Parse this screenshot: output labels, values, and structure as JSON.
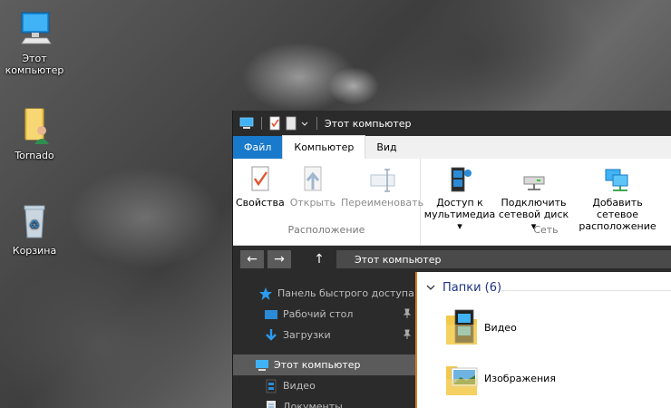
{
  "desktop": {
    "icons": [
      {
        "label_line1": "Этот",
        "label_line2": "компьютер",
        "icon": "computer-icon"
      },
      {
        "label_line1": "Tornado",
        "label_line2": "",
        "icon": "user-folder-icon"
      },
      {
        "label_line1": "Корзина",
        "label_line2": "",
        "icon": "recycle-bin-icon"
      }
    ]
  },
  "window": {
    "title": "Этот компьютер",
    "tabs": [
      {
        "label": "Файл"
      },
      {
        "label": "Компьютер"
      },
      {
        "label": "Вид"
      }
    ],
    "ribbon": {
      "groups": [
        {
          "label": "Расположение",
          "buttons": [
            {
              "label": "Свойства",
              "icon": "properties-icon"
            },
            {
              "label": "Открыть",
              "icon": "open-icon"
            },
            {
              "label": "Переименовать",
              "icon": "rename-icon"
            }
          ]
        },
        {
          "label": "Сеть",
          "buttons": [
            {
              "label_line1": "Доступ к",
              "label_line2": "мультимедиа ▾",
              "icon": "media-access-icon"
            },
            {
              "label_line1": "Подключить",
              "label_line2": "сетевой диск ▾",
              "icon": "map-drive-icon"
            },
            {
              "label_line1": "Добавить сетевое",
              "label_line2": "расположение",
              "icon": "network-location-icon"
            }
          ]
        }
      ]
    },
    "address": {
      "path": "Этот компьютер"
    },
    "nav": {
      "items": [
        {
          "label": "Панель быстрого доступа",
          "icon": "star-icon"
        },
        {
          "label": "Рабочий стол",
          "icon": "desktop-icon",
          "pinned": true
        },
        {
          "label": "Загрузки",
          "icon": "download-icon",
          "pinned": true
        },
        {
          "label": "Этот компьютер",
          "icon": "computer-icon",
          "selected": true
        },
        {
          "label": "Видео",
          "icon": "video-icon"
        },
        {
          "label": "Документы",
          "icon": "documents-icon"
        }
      ]
    },
    "content": {
      "section_title": "Папки (6)",
      "folders": [
        {
          "label": "Видео",
          "icon": "video-folder-icon"
        },
        {
          "label": "Изображения",
          "icon": "pictures-folder-icon"
        }
      ]
    }
  }
}
